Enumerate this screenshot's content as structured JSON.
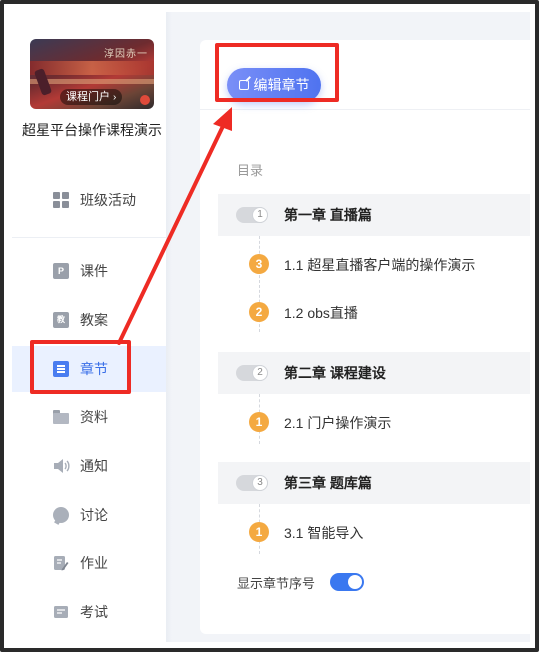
{
  "sidebar": {
    "cover": {
      "badge_label": "课程门户",
      "badge_chevron": "›",
      "script_text": "淳因赤一"
    },
    "course_title": "超星平台操作课程演示",
    "items": [
      {
        "label": "班级活动",
        "icon": "grid-icon"
      },
      {
        "label": "课件",
        "icon": "courseware-doc-icon",
        "glyph": "P"
      },
      {
        "label": "教案",
        "icon": "lesson-plan-doc-icon",
        "glyph": "教"
      },
      {
        "label": "章节",
        "icon": "chapter-list-icon",
        "active": true
      },
      {
        "label": "资料",
        "icon": "folder-icon"
      },
      {
        "label": "通知",
        "icon": "speaker-icon"
      },
      {
        "label": "讨论",
        "icon": "chat-bubble-icon"
      },
      {
        "label": "作业",
        "icon": "homework-icon"
      },
      {
        "label": "考试",
        "icon": "exam-icon"
      }
    ]
  },
  "main": {
    "edit_button": "编辑章节",
    "toc_label": "目录",
    "chapters": [
      {
        "num": "1",
        "title": "第一章 直播篇",
        "sections": [
          {
            "badge": "3",
            "title": "1.1 超星直播客户端的操作演示"
          },
          {
            "badge": "2",
            "title": "1.2 obs直播"
          }
        ]
      },
      {
        "num": "2",
        "title": "第二章 课程建设",
        "sections": [
          {
            "badge": "1",
            "title": "2.1 门户操作演示"
          }
        ]
      },
      {
        "num": "3",
        "title": "第三章 题库篇",
        "sections": [
          {
            "badge": "1",
            "title": "3.1 智能导入"
          }
        ]
      }
    ],
    "show_number_label": "显示章节序号",
    "show_number_enabled": true
  },
  "colors": {
    "accent": "#3a78f0",
    "badge": "#f4a941",
    "annotation_red": "#ee2b24",
    "active_bg": "#eaf1ff"
  }
}
